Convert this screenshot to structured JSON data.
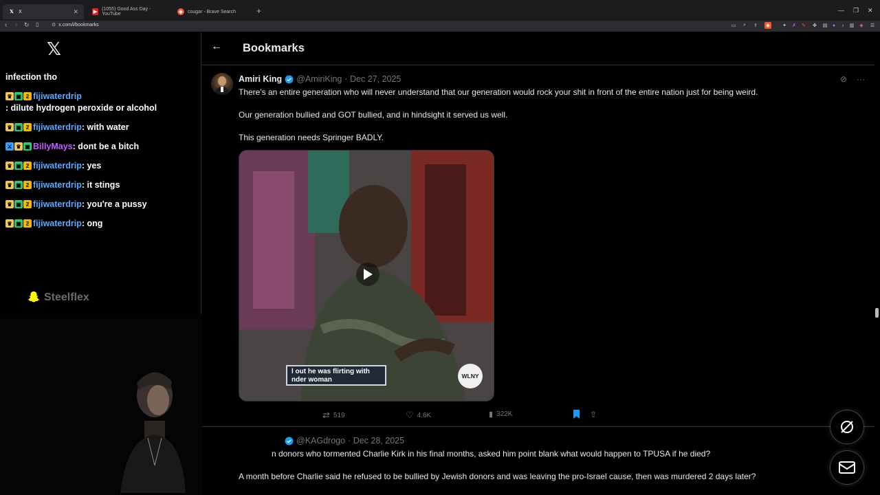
{
  "browser": {
    "tabs": [
      {
        "label": "X",
        "favicon": "X"
      },
      {
        "label": "(1055) Good Ass Day - YouTube",
        "favicon": "youtube"
      },
      {
        "label": "cougar - Brave Search",
        "favicon": "brave"
      }
    ],
    "url": "x.com/i/bookmarks"
  },
  "chat": {
    "cut_line": "infection tho",
    "messages": [
      {
        "user": "fijiwaterdrip",
        "text": ": dilute hydrogen peroxide or alcohol",
        "color": "#5aa9ff"
      },
      {
        "user": "fijiwaterdrip",
        "text": ": with water",
        "color": "#5aa9ff"
      },
      {
        "user": "BillyMays",
        "text": ": dont be a bitch",
        "color": "#c45cff"
      },
      {
        "user": "fijiwaterdrip",
        "text": ": yes",
        "color": "#5aa9ff"
      },
      {
        "user": "fijiwaterdrip",
        "text": ": it stings",
        "color": "#5aa9ff"
      },
      {
        "user": "fijiwaterdrip",
        "text": ": you're a pussy",
        "color": "#5aa9ff"
      },
      {
        "user": "fijiwaterdrip",
        "text": ": ong",
        "color": "#5aa9ff"
      }
    ],
    "snap_handle": "Steelflex"
  },
  "page": {
    "title": "Bookmarks"
  },
  "tweet1": {
    "name": "Amiri King",
    "handle": "@AmiriKing",
    "date": "· Dec 27, 2025",
    "paragraphs": [
      "There's an entire generation who will never understand that our generation would rock your shit in front of the entire nation just for being weird.",
      "Our generation bullied and GOT bullied, and in hindsight it served us well.",
      "This generation needs Springer BADLY."
    ],
    "video_caption": "l out he was flirting with\nnder woman",
    "station_logo": "WLNY",
    "stats": {
      "retweets": "519",
      "likes": "4.6K",
      "views": "322K"
    }
  },
  "tweet2": {
    "handle": "@KAGdrogo",
    "date": "· Dec 28, 2025",
    "paragraphs": [
      "n donors who tormented Charlie Kirk in his final months, asked him point blank what would happen to TPUSA if he died?",
      "A month before Charlie said he refused to be bullied by Jewish donors and was leaving the pro-Israel cause, then was murdered 2 days later?"
    ]
  },
  "colors": {
    "accent": "#1d9bf0",
    "muted": "#71767b",
    "border": "#2f3336"
  }
}
